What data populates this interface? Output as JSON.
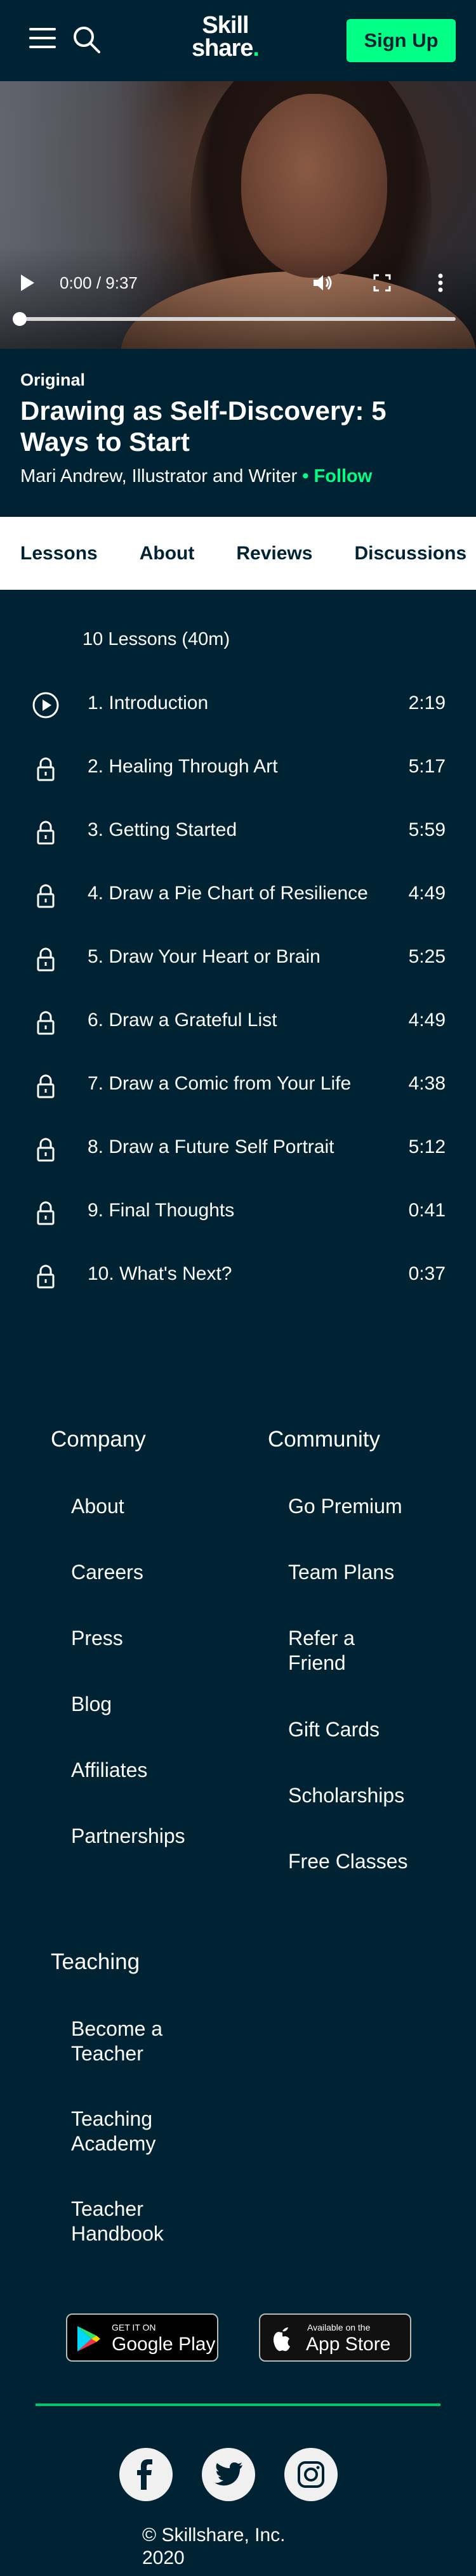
{
  "header": {
    "logo_line1": "Skill",
    "logo_line2": "share",
    "logo_dot": ".",
    "signup_label": "Sign Up"
  },
  "video": {
    "time": "0:00 / 9:37",
    "progress_fraction": 0
  },
  "class_info": {
    "badge": "Original",
    "title": "Drawing as Self-Discovery: 5 Ways to Start",
    "teacher": "Mari Andrew, Illustrator and Writer",
    "separator": " • ",
    "follow_label": "Follow"
  },
  "tabs": [
    {
      "label": "Lessons"
    },
    {
      "label": "About"
    },
    {
      "label": "Reviews"
    },
    {
      "label": "Discussions"
    }
  ],
  "lessons": {
    "count_label": "10 Lessons (40m)",
    "items": [
      {
        "title": "1. Introduction",
        "duration": "2:19",
        "icon": "play-circle-icon"
      },
      {
        "title": "2. Healing Through Art",
        "duration": "5:17",
        "icon": "lock-icon"
      },
      {
        "title": "3. Getting Started",
        "duration": "5:59",
        "icon": "lock-icon"
      },
      {
        "title": "4. Draw a Pie Chart of Resilience",
        "duration": "4:49",
        "icon": "lock-icon"
      },
      {
        "title": "5. Draw Your Heart or Brain",
        "duration": "5:25",
        "icon": "lock-icon"
      },
      {
        "title": "6. Draw a Grateful List",
        "duration": "4:49",
        "icon": "lock-icon"
      },
      {
        "title": "7. Draw a Comic from Your Life",
        "duration": "4:38",
        "icon": "lock-icon"
      },
      {
        "title": "8. Draw a Future Self Portrait",
        "duration": "5:12",
        "icon": "lock-icon"
      },
      {
        "title": "9. Final Thoughts",
        "duration": "0:41",
        "icon": "lock-icon"
      },
      {
        "title": "10. What's Next?",
        "duration": "0:37",
        "icon": "lock-icon"
      }
    ]
  },
  "footer": {
    "company": {
      "heading": "Company",
      "links": [
        "About",
        "Careers",
        "Press",
        "Blog",
        "Affiliates",
        "Partnerships"
      ]
    },
    "community": {
      "heading": "Community",
      "links": [
        "Go Premium",
        "Team Plans",
        "Refer a Friend",
        "Gift Cards",
        "Scholarships",
        "Free Classes"
      ]
    },
    "teaching": {
      "heading": "Teaching",
      "links": [
        "Become a Teacher",
        "Teaching Academy",
        "Teacher Handbook"
      ]
    },
    "google_play": {
      "small": "GET IT ON",
      "big": "Google Play"
    },
    "app_store": {
      "small": "Available on the",
      "big": "App Store"
    },
    "social": [
      "facebook-icon",
      "twitter-icon",
      "instagram-icon"
    ],
    "copyright_line1": "© Skillshare, Inc.",
    "copyright_line2": "2020"
  },
  "colors": {
    "background": "#002333",
    "accent": "#00ff84"
  }
}
